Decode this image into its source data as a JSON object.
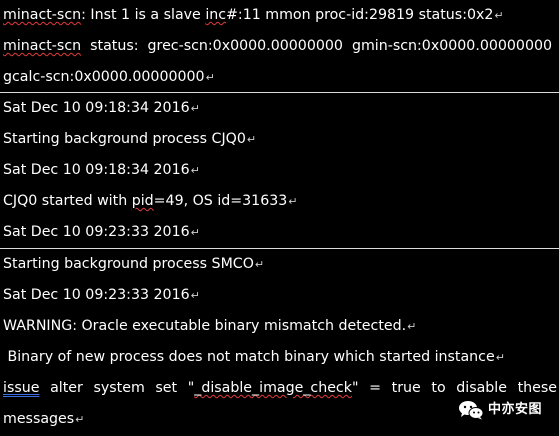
{
  "lines": [
    {
      "parts": [
        "minact-scn",
        ": Inst 1 is a slave ",
        "inc",
        "#:11 mmon proc-id:29819 status:0x2"
      ]
    },
    {
      "parts": [
        "minact-scn",
        "  status:  grec-scn:0x0000.00000000  gmin-scn:0x0000.00000000"
      ]
    },
    {
      "parts": [
        "gcalc-scn:0x0000.00000000"
      ]
    },
    {
      "parts": [
        "Sat Dec 10 09:18:34 2016"
      ]
    },
    {
      "parts": [
        "Starting background process CJQ0"
      ]
    },
    {
      "parts": [
        "Sat Dec 10 09:18:34 2016"
      ]
    },
    {
      "parts": [
        "CJQ0 started with ",
        "pid",
        "=49, OS id=31633"
      ]
    },
    {
      "parts": [
        "Sat Dec 10 09:23:33 2016"
      ]
    },
    {
      "parts": [
        "Starting background process SMCO"
      ]
    },
    {
      "parts": [
        "Sat Dec 10 09:23:33 2016"
      ]
    },
    {
      "parts": [
        "WARNING: Oracle executable binary mismatch detected."
      ]
    },
    {
      "parts": [
        " Binary of new process does not match binary which started instance"
      ]
    },
    {
      "words": [
        "issue",
        "alter",
        "system",
        "set",
        "\"",
        "_disable_image_check",
        "\"",
        "=",
        "true",
        "to",
        "disable",
        "these"
      ]
    },
    {
      "parts": [
        "messages"
      ]
    }
  ],
  "paragraph_mark": "↵",
  "watermark": {
    "text": "中亦安图",
    "icon": "wechat-icon"
  }
}
